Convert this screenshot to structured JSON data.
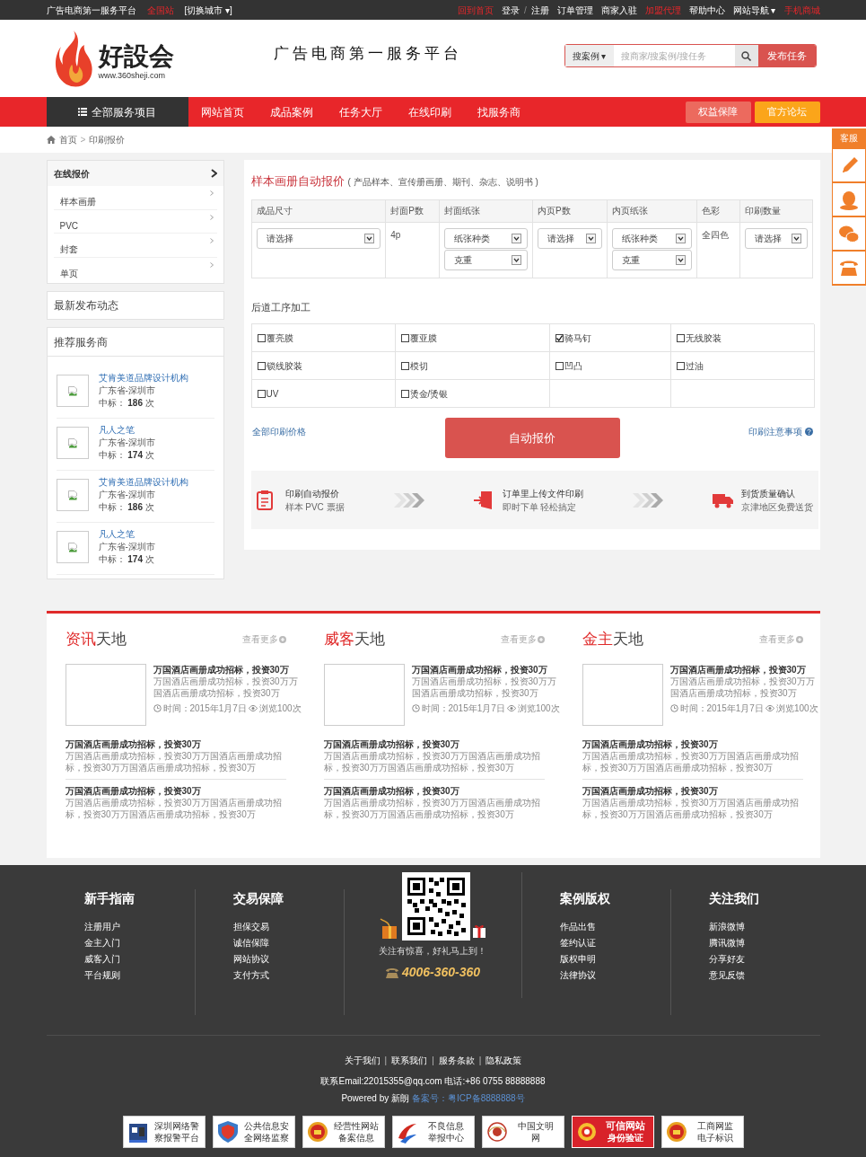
{
  "top_bar": {
    "slogan": "广告电商第一服务平台",
    "site": "全国站",
    "city_switch": "[切换城市 ▾]",
    "links": [
      {
        "label": "回到首页",
        "highlight": true
      },
      {
        "label": "登录",
        "highlight": false
      },
      {
        "label": "/",
        "kind": "sep"
      },
      {
        "label": "注册",
        "highlight": false
      },
      {
        "label": "订单管理",
        "highlight": false
      },
      {
        "label": "商家入驻",
        "highlight": false
      },
      {
        "label": "加盟代理",
        "highlight": true
      },
      {
        "label": "帮助中心",
        "highlight": false
      },
      {
        "label": "网站导航 ▾",
        "highlight": false
      },
      {
        "label": "手机商城",
        "highlight": true
      }
    ]
  },
  "header": {
    "logo_text": "好設会",
    "logo_url": "www.360sheji.com",
    "slogan": "广告电商第一服务平台",
    "search": {
      "scope": "搜案例 ▾",
      "placeholder": "搜商家/搜案例/搜任务",
      "button": "发布任务"
    }
  },
  "nav": {
    "all_services": "全部服务项目",
    "items": [
      {
        "label": "网站首页"
      },
      {
        "label": "成品案例"
      },
      {
        "label": "任务大厅"
      },
      {
        "label": "在线印刷"
      },
      {
        "label": "找服务商"
      }
    ],
    "buttons": [
      {
        "label": "权益保障",
        "color": "#ec6a5e"
      },
      {
        "label": "官方论坛",
        "color": "#fba51a"
      }
    ]
  },
  "breadcrumb": [
    {
      "kind": "link",
      "label": "首页"
    },
    {
      "kind": "sep",
      "label": ">"
    },
    {
      "kind": "link",
      "label": "印刷报价"
    }
  ],
  "side_float": {
    "title": "客服"
  },
  "sidebar": {
    "quote_title": "在线报价",
    "quote_items": [
      "样本画册",
      "PVC",
      "封套",
      "单页"
    ],
    "latest_title": "最新发布动态",
    "providers_title": "推荐服务商",
    "providers": [
      {
        "name": "艾肯美道品牌设计机构",
        "location": "广东省-深圳市",
        "bids_label": "中标：",
        "bids": "186",
        "bids_unit": "次"
      },
      {
        "name": "凡人之笔",
        "location": "广东省-深圳市",
        "bids_label": "中标：",
        "bids": "174",
        "bids_unit": "次"
      },
      {
        "name": "艾肯美道品牌设计机构",
        "location": "广东省-深圳市",
        "bids_label": "中标：",
        "bids": "186",
        "bids_unit": "次"
      },
      {
        "name": "凡人之笔",
        "location": "广东省-深圳市",
        "bids_label": "中标：",
        "bids": "174",
        "bids_unit": "次"
      }
    ]
  },
  "quote": {
    "title": "样本画册自动报价",
    "subtitle": "( 产品样本、宣传册画册、期刊、杂志、说明书 )",
    "columns": [
      "成品尺寸",
      "封面P数",
      "封面纸张",
      "内页P数",
      "内页纸张",
      "色彩",
      "印刷数量"
    ],
    "cells": [
      {
        "kind": "select",
        "options": [
          "请选择"
        ]
      },
      {
        "kind": "text",
        "text": "4p"
      },
      {
        "kind": "select",
        "options": [
          "纸张种类",
          "克重"
        ]
      },
      {
        "kind": "select",
        "options": [
          "请选择"
        ]
      },
      {
        "kind": "select",
        "options": [
          "纸张种类",
          "克重"
        ]
      },
      {
        "kind": "text",
        "text": "全四色"
      },
      {
        "kind": "select",
        "options": [
          "请选择"
        ]
      }
    ],
    "finishing_title": "后道工序加工",
    "finishing": [
      {
        "label": "覆亮膜",
        "checked": false
      },
      {
        "label": "覆亚膜",
        "checked": false
      },
      {
        "label": "骑马钉",
        "checked": true
      },
      {
        "label": "无线胶装",
        "checked": false
      },
      {
        "label": "锁线胶装",
        "checked": false
      },
      {
        "label": "模切",
        "checked": false
      },
      {
        "label": "凹凸",
        "checked": false
      },
      {
        "label": "过油",
        "checked": false
      },
      {
        "label": "UV",
        "checked": false
      },
      {
        "label": "烫金/烫银",
        "checked": false
      }
    ],
    "all_prices_link": "全部印刷价格",
    "submit": "自动报价",
    "notes_link": "印刷注意事项",
    "steps": [
      {
        "kind": "clipboard",
        "title": "印刷自动报价",
        "desc": "样本 PVC 票据"
      },
      {
        "kind": "upload",
        "title": "订单里上传文件印刷",
        "desc": "即时下单 轻松搞定"
      },
      {
        "kind": "truck",
        "title": "到货质量确认",
        "desc": "京津地区免费送货"
      }
    ]
  },
  "info": [
    {
      "title_highlight": "资讯",
      "title_rest": "天地",
      "more": "查看更多",
      "featured": {
        "title": "万国酒店画册成功招标，投资30万",
        "summary": "万国酒店画册成功招标，投资30万万国酒店画册成功招标，投资30万",
        "time": "时间：2015年1月7日",
        "views": "浏览100次"
      },
      "items": [
        {
          "title": "万国酒店画册成功招标，投资30万",
          "summary": "万国酒店画册成功招标，投资30万万国酒店画册成功招标，投资30万万国酒店画册成功招标，投资30万"
        },
        {
          "title": "万国酒店画册成功招标，投资30万",
          "summary": "万国酒店画册成功招标，投资30万万国酒店画册成功招标，投资30万万国酒店画册成功招标，投资30万"
        }
      ]
    },
    {
      "title_highlight": "威客",
      "title_rest": "天地",
      "more": "查看更多",
      "featured": {
        "title": "万国酒店画册成功招标，投资30万",
        "summary": "万国酒店画册成功招标，投资30万万国酒店画册成功招标，投资30万",
        "time": "时间：2015年1月7日",
        "views": "浏览100次"
      },
      "items": [
        {
          "title": "万国酒店画册成功招标，投资30万",
          "summary": "万国酒店画册成功招标，投资30万万国酒店画册成功招标，投资30万万国酒店画册成功招标，投资30万"
        },
        {
          "title": "万国酒店画册成功招标，投资30万",
          "summary": "万国酒店画册成功招标，投资30万万国酒店画册成功招标，投资30万万国酒店画册成功招标，投资30万"
        }
      ]
    },
    {
      "title_highlight": "金主",
      "title_rest": "天地",
      "more": "查看更多",
      "featured": {
        "title": "万国酒店画册成功招标，投资30万",
        "summary": "万国酒店画册成功招标，投资30万万国酒店画册成功招标，投资30万",
        "time": "时间：2015年1月7日",
        "views": "浏览100次"
      },
      "items": [
        {
          "title": "万国酒店画册成功招标，投资30万",
          "summary": "万国酒店画册成功招标，投资30万万国酒店画册成功招标，投资30万万国酒店画册成功招标，投资30万"
        },
        {
          "title": "万国酒店画册成功招标，投资30万",
          "summary": "万国酒店画册成功招标，投资30万万国酒店画册成功招标，投资30万万国酒店画册成功招标，投资30万"
        }
      ]
    }
  ],
  "footer": {
    "columns_left": [
      {
        "title": "新手指南",
        "links": [
          "注册用户",
          "金主入门",
          "威客入门",
          "平台规则"
        ]
      },
      {
        "title": "交易保障",
        "links": [
          "担保交易",
          "诚信保障",
          "网站协议",
          "支付方式"
        ]
      }
    ],
    "qr_caption": "关注有惊喜，好礼马上到！",
    "phone": "4006-360-360",
    "columns_right": [
      {
        "title": "案例版权",
        "links": [
          "作品出售",
          "签约认证",
          "版权申明",
          "法律协议"
        ]
      },
      {
        "title": "关注我们",
        "links": [
          "新浪微博",
          "腾讯微博",
          "分享好友",
          "意见反馈"
        ]
      }
    ],
    "bottom_links": [
      {
        "kind": "link",
        "label": "关于我们"
      },
      {
        "kind": "sep",
        "label": "|"
      },
      {
        "kind": "link",
        "label": "联系我们"
      },
      {
        "kind": "sep",
        "label": "|"
      },
      {
        "kind": "link",
        "label": "服务条款"
      },
      {
        "kind": "sep",
        "label": "|"
      },
      {
        "kind": "link",
        "label": "隐私政策"
      }
    ],
    "contact": "联系Email:22015355@qq.com 电话:+86 0755 88888888",
    "powered": "Powered by 新朗",
    "icp": "备案号：粤ICP备8888888号",
    "badges": [
      {
        "kind": "police",
        "lines": [
          "深圳网络警",
          "察报警平台"
        ]
      },
      {
        "kind": "shield",
        "lines": [
          "公共信息安",
          "全网络监察"
        ]
      },
      {
        "kind": "emblem",
        "lines": [
          "经营性网站",
          "备案信息"
        ]
      },
      {
        "kind": "swoosh",
        "lines": [
          "不良信息",
          "举报中心"
        ]
      },
      {
        "kind": "flower",
        "lines": [
          "中国文明",
          "网"
        ]
      },
      {
        "kind": "trusted",
        "lines": [
          "可信网站",
          "身份验证"
        ]
      },
      {
        "kind": "emblem",
        "lines": [
          "工商网监",
          "电子标识"
        ]
      }
    ]
  }
}
